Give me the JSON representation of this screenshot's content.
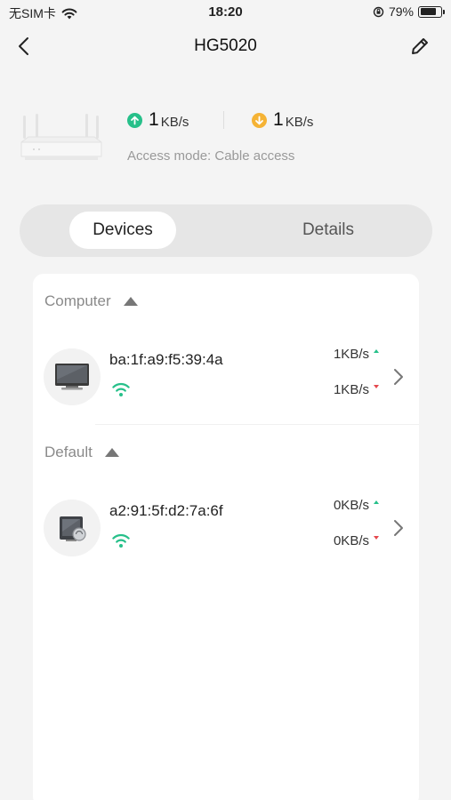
{
  "status_bar": {
    "carrier": "无SIM卡",
    "time": "18:20",
    "battery_percent": "79%",
    "battery_level": 0.79
  },
  "nav": {
    "title": "HG5020"
  },
  "router": {
    "upload_value": "1",
    "upload_unit": "KB/s",
    "download_value": "1",
    "download_unit": "KB/s",
    "access_mode": "Access mode: Cable access",
    "colors": {
      "upload": "#27c08a",
      "download": "#f5b335"
    }
  },
  "tabs": [
    {
      "label": "Devices",
      "active": true
    },
    {
      "label": "Details",
      "active": false
    }
  ],
  "groups": [
    {
      "name": "Computer",
      "devices": [
        {
          "mac": "ba:1f:a9:f5:39:4a",
          "upload": "1KB/s",
          "download": "1KB/s",
          "icon": "monitor-icon"
        }
      ]
    },
    {
      "name": "Default",
      "devices": [
        {
          "mac": "a2:91:5f:d2:7a:6f",
          "upload": "0KB/s",
          "download": "0KB/s",
          "icon": "generic-device-icon"
        }
      ]
    }
  ]
}
